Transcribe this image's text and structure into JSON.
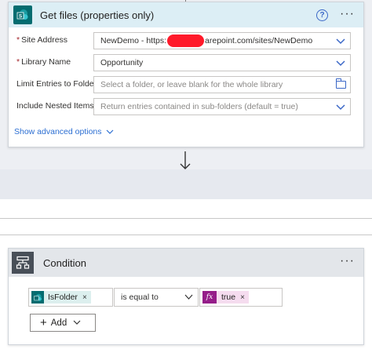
{
  "get_files": {
    "title": "Get files (properties only)",
    "help_glyph": "?",
    "more_glyph": "···",
    "fields": [
      {
        "label": "Site Address",
        "required": true,
        "value_prefix": "NewDemo - https:",
        "value_suffix": "arepoint.com/sites/NewDemo",
        "control": "dropdown"
      },
      {
        "label": "Library Name",
        "required": true,
        "value": "Opportunity",
        "control": "dropdown"
      },
      {
        "label": "Limit Entries to Folder",
        "required": false,
        "placeholder": "Select a folder, or leave blank for the whole library",
        "control": "folder-picker"
      },
      {
        "label": "Include Nested Items",
        "required": false,
        "placeholder": "Return entries contained in sub-folders (default = true)",
        "control": "dropdown"
      }
    ],
    "required_marker": "*",
    "show_advanced": "Show advanced options"
  },
  "condition": {
    "title": "Condition",
    "more_glyph": "···",
    "left_token": "IsFolder",
    "operator": "is equal to",
    "right_token": "true",
    "fx_glyph": "fx",
    "remove_glyph": "×",
    "add_label": "Add",
    "add_glyph": "+"
  },
  "colors": {
    "sharepoint": "#036c70",
    "expression": "#951d89",
    "accent": "#2b6ed2",
    "card_header": "#dceef5",
    "redaction": "#ff1a2a"
  }
}
